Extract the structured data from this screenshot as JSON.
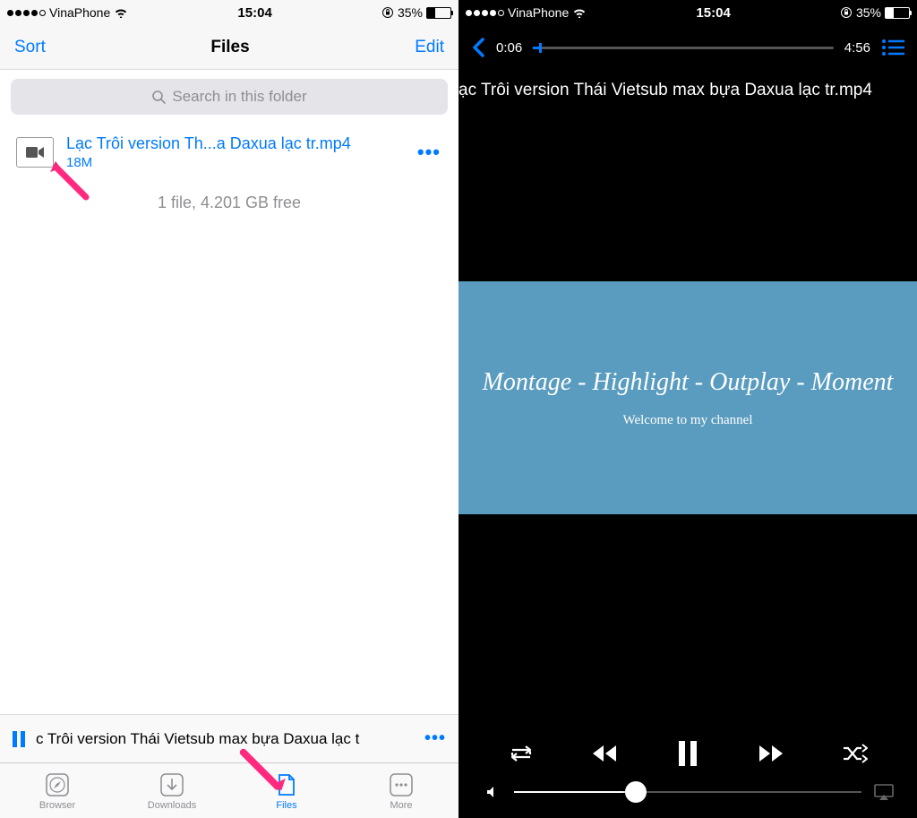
{
  "status": {
    "carrier": "VinaPhone",
    "time": "15:04",
    "battery_pct": "35%",
    "battery_fill": 35
  },
  "left": {
    "nav": {
      "sort": "Sort",
      "title": "Files",
      "edit": "Edit"
    },
    "search": {
      "placeholder": "Search in this folder"
    },
    "file": {
      "name": "Lạc Trôi version Th...a Daxua lạc tr.mp4",
      "size": "18M"
    },
    "storage": "1 file, 4.201 GB free",
    "now_playing": "c Trôi version Thái Vietsub max bựa Daxua lạc t",
    "tabs": {
      "browser": "Browser",
      "downloads": "Downloads",
      "files": "Files",
      "more": "More"
    }
  },
  "right": {
    "time_current": "0:06",
    "time_total": "4:56",
    "seek_pct": 2,
    "filename": "ạc Trôi version Thái Vietsub max bựa Daxua lạc tr.mp4",
    "video": {
      "title": "Montage - Highlight - Outplay - Moment",
      "subtitle": "Welcome to my channel"
    },
    "volume_pct": 35
  }
}
